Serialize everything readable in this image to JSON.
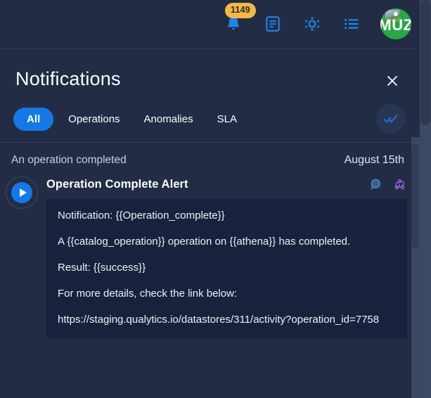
{
  "topbar": {
    "notifications": {
      "icon": "bell-icon",
      "badge_count": "1149",
      "badge_color": "#f3b845"
    },
    "docs": {
      "icon": "document-icon"
    },
    "theme": {
      "icon": "brightness-icon"
    },
    "activity": {
      "icon": "list-icon"
    },
    "avatar": {
      "initials": "MUZ",
      "color": "#29a745"
    }
  },
  "panel": {
    "title": "Notifications",
    "close_label": "×",
    "close_icon": "close-icon",
    "mark_all_read_icon": "double-check-icon",
    "tabs": [
      {
        "label": "All",
        "active": true
      },
      {
        "label": "Operations",
        "active": false
      },
      {
        "label": "Anomalies",
        "active": false
      },
      {
        "label": "SLA",
        "active": false
      }
    ],
    "accent_color": "#1479e8"
  },
  "notification_group": {
    "label": "An operation completed",
    "date": "August 15th"
  },
  "notification": {
    "play_icon": "play-icon",
    "title": "Operation Complete Alert",
    "actions": [
      {
        "icon": "search-icon",
        "color": "#2f7fd6"
      },
      {
        "icon": "webhook-icon",
        "color": "#9d5fd8"
      }
    ],
    "message": {
      "line1": "Notification: {{Operation_complete}}",
      "line2": "A {{catalog_operation}} operation on {{athena}} has completed.",
      "line3": "Result: {{success}}",
      "line4": "For more details, check the link below:",
      "line5": "https://staging.qualytics.io/datastores/311/activity?operation_id=7758"
    }
  }
}
